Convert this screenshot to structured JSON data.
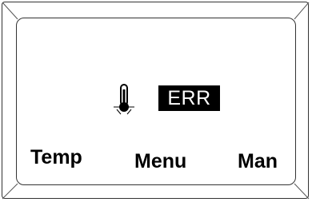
{
  "display": {
    "status": {
      "icon": "thermometer-icon",
      "error_text": "ERR"
    },
    "softkeys": {
      "left": "Temp",
      "center": "Menu",
      "right": "Man"
    }
  }
}
